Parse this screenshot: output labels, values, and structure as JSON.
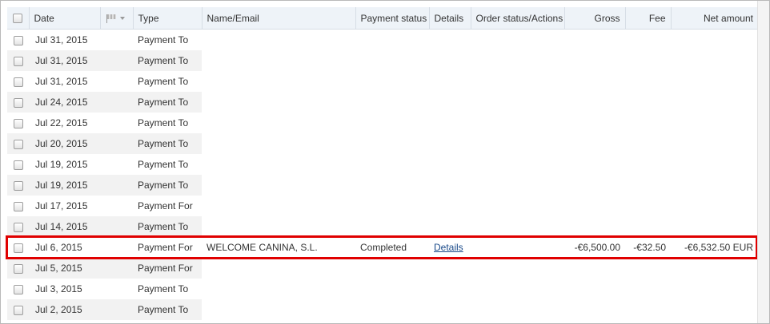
{
  "columns": {
    "date": "Date",
    "type": "Type",
    "name_email": "Name/Email",
    "payment_status": "Payment status",
    "details": "Details",
    "order_status": "Order status/Actions",
    "gross": "Gross",
    "fee": "Fee",
    "net_amount": "Net amount"
  },
  "rows": [
    {
      "date": "Jul 31, 2015",
      "type": "Payment To"
    },
    {
      "date": "Jul 31, 2015",
      "type": "Payment To"
    },
    {
      "date": "Jul 31, 2015",
      "type": "Payment To"
    },
    {
      "date": "Jul 24, 2015",
      "type": "Payment To"
    },
    {
      "date": "Jul 22, 2015",
      "type": "Payment To"
    },
    {
      "date": "Jul 20, 2015",
      "type": "Payment To"
    },
    {
      "date": "Jul 19, 2015",
      "type": "Payment To"
    },
    {
      "date": "Jul 19, 2015",
      "type": "Payment To"
    },
    {
      "date": "Jul 17, 2015",
      "type": "Payment For"
    },
    {
      "date": "Jul 14, 2015",
      "type": "Payment To"
    },
    {
      "date": "Jul 6, 2015",
      "type": "Payment For",
      "name": "WELCOME CANINA, S.L.",
      "status": "Completed",
      "details_link": "Details",
      "gross": "-€6,500.00",
      "fee": "-€32.50",
      "net": "-€6,532.50 EUR"
    },
    {
      "date": "Jul 5, 2015",
      "type": "Payment For"
    },
    {
      "date": "Jul 3, 2015",
      "type": "Payment To"
    },
    {
      "date": "Jul 2, 2015",
      "type": "Payment To"
    }
  ],
  "icons": {
    "header_checkbox": "checkbox-icon",
    "flag_filter": "flag-icon",
    "flag_dropdown": "chevron-down-icon",
    "row_checkbox": "checkbox-icon"
  },
  "colors": {
    "highlight_border": "#e00000",
    "header_bg": "#eef3f8",
    "row_band": "#f2f2f2",
    "link": "#1a4a8a"
  }
}
